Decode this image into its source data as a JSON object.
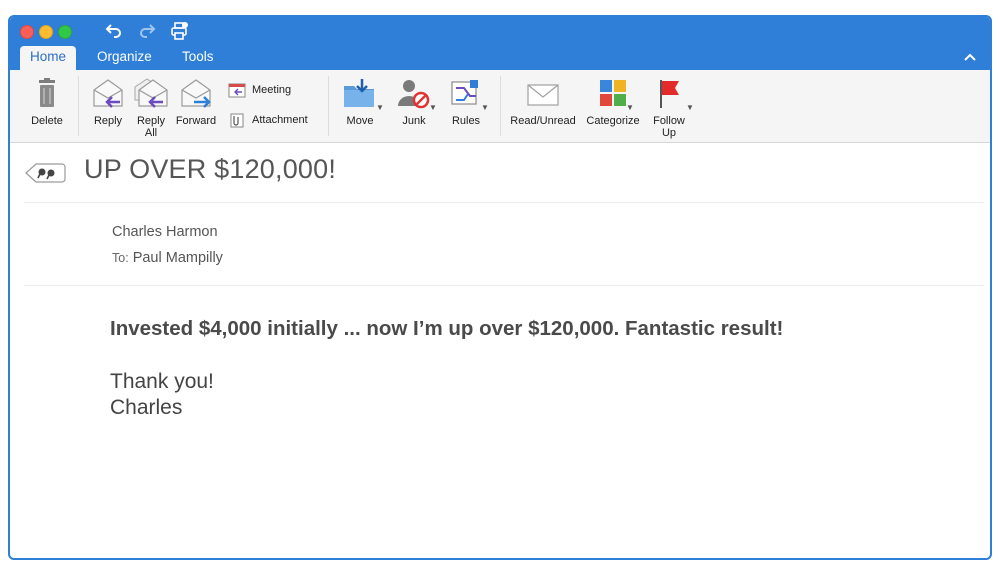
{
  "toolbar_icons": [
    "undo-icon",
    "redo-icon",
    "print-icon"
  ],
  "tabs": [
    {
      "label": "Home",
      "active": true
    },
    {
      "label": "Organize",
      "active": false
    },
    {
      "label": "Tools",
      "active": false
    }
  ],
  "ribbon": {
    "delete": "Delete",
    "reply": "Reply",
    "reply_all": "Reply\nAll",
    "forward": "Forward",
    "meeting": "Meeting",
    "attachment": "Attachment",
    "move": "Move",
    "junk": "Junk",
    "rules": "Rules",
    "read_unread": "Read/Unread",
    "categorize": "Categorize",
    "follow_up": "Follow\nUp"
  },
  "message": {
    "subject": "UP OVER $120,000!",
    "sender": "Charles Harmon",
    "to_label": "To:",
    "to": "Paul Mampilly",
    "body_bold": "Invested $4,000 initially ... now I’m up over $120,000. Fantastic result!",
    "body_lines": [
      "Thank you!",
      "Charles"
    ]
  },
  "colors": {
    "titlebar": "#2f7ed8",
    "ribbon_bg": "#f5f5f5",
    "flag": "#e32b2b",
    "accent_text": "#2a6fc7"
  }
}
